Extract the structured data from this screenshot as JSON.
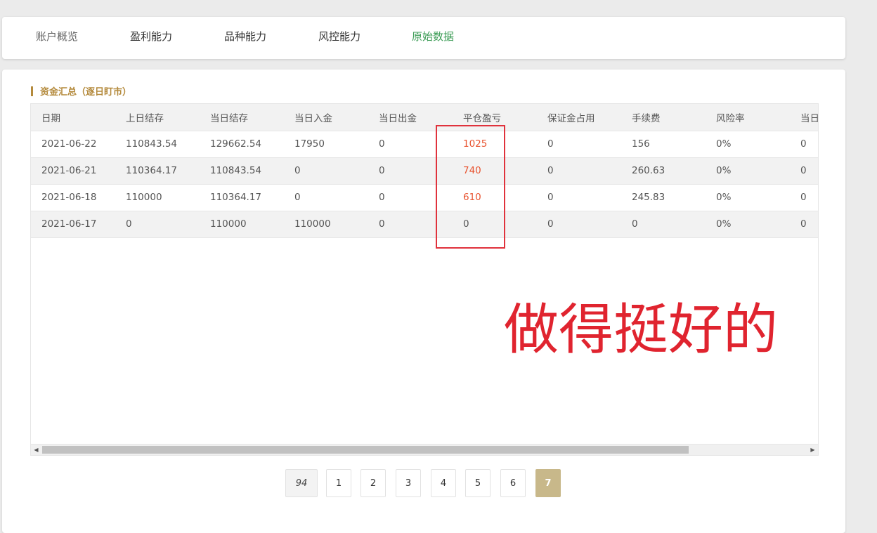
{
  "nav": {
    "tabs": [
      {
        "label": "账户概览"
      },
      {
        "label": "盈利能力"
      },
      {
        "label": "品种能力"
      },
      {
        "label": "风控能力"
      },
      {
        "label": "原始数据"
      }
    ]
  },
  "section": {
    "title": "资金汇总（逐日盯市）"
  },
  "table": {
    "headers": [
      "日期",
      "上日结存",
      "当日结存",
      "当日入金",
      "当日出金",
      "平仓盈亏",
      "保证金占用",
      "手续费",
      "风险率",
      "当日"
    ],
    "rows": [
      [
        "2021-06-22",
        "110843.54",
        "129662.54",
        "17950",
        "0",
        "1025",
        "0",
        "156",
        "0%",
        "0"
      ],
      [
        "2021-06-21",
        "110364.17",
        "110843.54",
        "0",
        "0",
        "740",
        "0",
        "260.63",
        "0%",
        "0"
      ],
      [
        "2021-06-18",
        "110000",
        "110364.17",
        "0",
        "0",
        "610",
        "0",
        "245.83",
        "0%",
        "0"
      ],
      [
        "2021-06-17",
        "0",
        "110000",
        "110000",
        "0",
        "0",
        "0",
        "0",
        "0%",
        "0"
      ]
    ]
  },
  "annotation": {
    "text": "做得挺好的"
  },
  "pagination": {
    "page_size": "94",
    "pages": [
      "1",
      "2",
      "3",
      "4",
      "5",
      "6",
      "7"
    ],
    "current": "7"
  },
  "colors": {
    "active_tab": "#3a9b54",
    "section_title": "#b48a3c",
    "profit_text": "#e8532f",
    "annotation_red": "#e0242f",
    "current_page": "#c8b88a"
  },
  "icons": {
    "scroll_left": "scroll-left-arrow-icon",
    "scroll_right": "scroll-right-arrow-icon"
  }
}
